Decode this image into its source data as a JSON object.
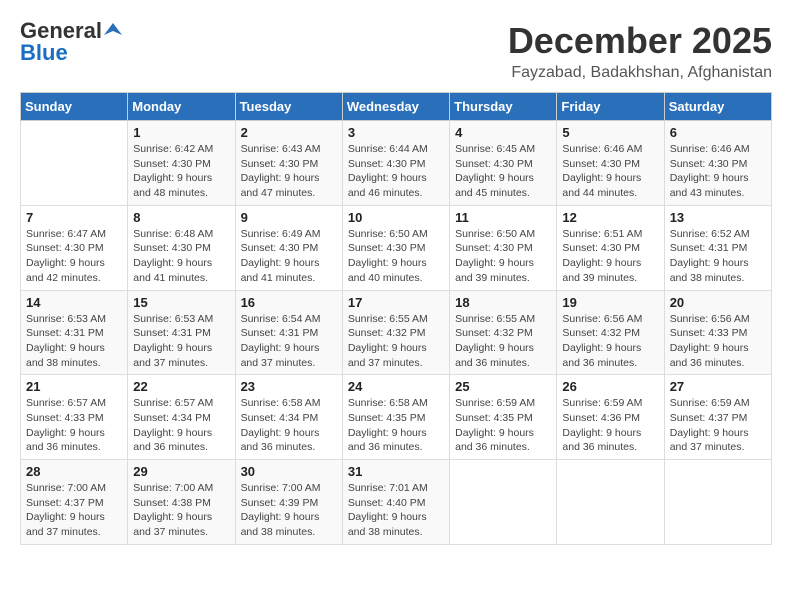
{
  "logo": {
    "general": "General",
    "blue": "Blue"
  },
  "title": {
    "month": "December 2025",
    "location": "Fayzabad, Badakhshan, Afghanistan"
  },
  "days_of_week": [
    "Sunday",
    "Monday",
    "Tuesday",
    "Wednesday",
    "Thursday",
    "Friday",
    "Saturday"
  ],
  "weeks": [
    [
      {
        "day": "",
        "info": ""
      },
      {
        "day": "1",
        "info": "Sunrise: 6:42 AM\nSunset: 4:30 PM\nDaylight: 9 hours\nand 48 minutes."
      },
      {
        "day": "2",
        "info": "Sunrise: 6:43 AM\nSunset: 4:30 PM\nDaylight: 9 hours\nand 47 minutes."
      },
      {
        "day": "3",
        "info": "Sunrise: 6:44 AM\nSunset: 4:30 PM\nDaylight: 9 hours\nand 46 minutes."
      },
      {
        "day": "4",
        "info": "Sunrise: 6:45 AM\nSunset: 4:30 PM\nDaylight: 9 hours\nand 45 minutes."
      },
      {
        "day": "5",
        "info": "Sunrise: 6:46 AM\nSunset: 4:30 PM\nDaylight: 9 hours\nand 44 minutes."
      },
      {
        "day": "6",
        "info": "Sunrise: 6:46 AM\nSunset: 4:30 PM\nDaylight: 9 hours\nand 43 minutes."
      }
    ],
    [
      {
        "day": "7",
        "info": "Sunrise: 6:47 AM\nSunset: 4:30 PM\nDaylight: 9 hours\nand 42 minutes."
      },
      {
        "day": "8",
        "info": "Sunrise: 6:48 AM\nSunset: 4:30 PM\nDaylight: 9 hours\nand 41 minutes."
      },
      {
        "day": "9",
        "info": "Sunrise: 6:49 AM\nSunset: 4:30 PM\nDaylight: 9 hours\nand 41 minutes."
      },
      {
        "day": "10",
        "info": "Sunrise: 6:50 AM\nSunset: 4:30 PM\nDaylight: 9 hours\nand 40 minutes."
      },
      {
        "day": "11",
        "info": "Sunrise: 6:50 AM\nSunset: 4:30 PM\nDaylight: 9 hours\nand 39 minutes."
      },
      {
        "day": "12",
        "info": "Sunrise: 6:51 AM\nSunset: 4:30 PM\nDaylight: 9 hours\nand 39 minutes."
      },
      {
        "day": "13",
        "info": "Sunrise: 6:52 AM\nSunset: 4:31 PM\nDaylight: 9 hours\nand 38 minutes."
      }
    ],
    [
      {
        "day": "14",
        "info": "Sunrise: 6:53 AM\nSunset: 4:31 PM\nDaylight: 9 hours\nand 38 minutes."
      },
      {
        "day": "15",
        "info": "Sunrise: 6:53 AM\nSunset: 4:31 PM\nDaylight: 9 hours\nand 37 minutes."
      },
      {
        "day": "16",
        "info": "Sunrise: 6:54 AM\nSunset: 4:31 PM\nDaylight: 9 hours\nand 37 minutes."
      },
      {
        "day": "17",
        "info": "Sunrise: 6:55 AM\nSunset: 4:32 PM\nDaylight: 9 hours\nand 37 minutes."
      },
      {
        "day": "18",
        "info": "Sunrise: 6:55 AM\nSunset: 4:32 PM\nDaylight: 9 hours\nand 36 minutes."
      },
      {
        "day": "19",
        "info": "Sunrise: 6:56 AM\nSunset: 4:32 PM\nDaylight: 9 hours\nand 36 minutes."
      },
      {
        "day": "20",
        "info": "Sunrise: 6:56 AM\nSunset: 4:33 PM\nDaylight: 9 hours\nand 36 minutes."
      }
    ],
    [
      {
        "day": "21",
        "info": "Sunrise: 6:57 AM\nSunset: 4:33 PM\nDaylight: 9 hours\nand 36 minutes."
      },
      {
        "day": "22",
        "info": "Sunrise: 6:57 AM\nSunset: 4:34 PM\nDaylight: 9 hours\nand 36 minutes."
      },
      {
        "day": "23",
        "info": "Sunrise: 6:58 AM\nSunset: 4:34 PM\nDaylight: 9 hours\nand 36 minutes."
      },
      {
        "day": "24",
        "info": "Sunrise: 6:58 AM\nSunset: 4:35 PM\nDaylight: 9 hours\nand 36 minutes."
      },
      {
        "day": "25",
        "info": "Sunrise: 6:59 AM\nSunset: 4:35 PM\nDaylight: 9 hours\nand 36 minutes."
      },
      {
        "day": "26",
        "info": "Sunrise: 6:59 AM\nSunset: 4:36 PM\nDaylight: 9 hours\nand 36 minutes."
      },
      {
        "day": "27",
        "info": "Sunrise: 6:59 AM\nSunset: 4:37 PM\nDaylight: 9 hours\nand 37 minutes."
      }
    ],
    [
      {
        "day": "28",
        "info": "Sunrise: 7:00 AM\nSunset: 4:37 PM\nDaylight: 9 hours\nand 37 minutes."
      },
      {
        "day": "29",
        "info": "Sunrise: 7:00 AM\nSunset: 4:38 PM\nDaylight: 9 hours\nand 37 minutes."
      },
      {
        "day": "30",
        "info": "Sunrise: 7:00 AM\nSunset: 4:39 PM\nDaylight: 9 hours\nand 38 minutes."
      },
      {
        "day": "31",
        "info": "Sunrise: 7:01 AM\nSunset: 4:40 PM\nDaylight: 9 hours\nand 38 minutes."
      },
      {
        "day": "",
        "info": ""
      },
      {
        "day": "",
        "info": ""
      },
      {
        "day": "",
        "info": ""
      }
    ]
  ]
}
